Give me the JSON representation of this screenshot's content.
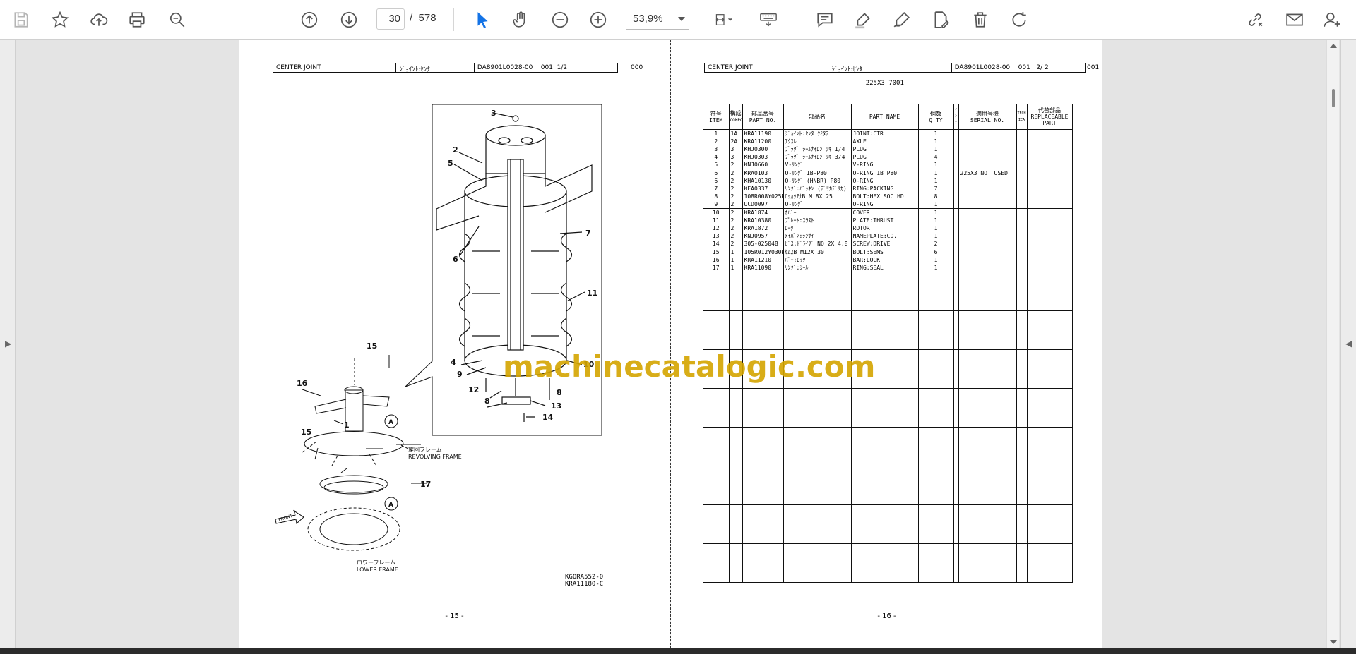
{
  "toolbar": {
    "page_current": "30",
    "page_separator": "/",
    "page_total": "578",
    "zoom": "53,9%"
  },
  "left_page": {
    "header": {
      "title": "CENTER JOINT",
      "jp_title": "ｼﾞｮｲﾝﾄ:ｾﾝﾀ",
      "doc_no": "DA8901L0028-00",
      "seq": "001",
      "sheet": "1/2",
      "rev": "000"
    },
    "callouts": [
      "1",
      "2",
      "3",
      "4",
      "5",
      "6",
      "7",
      "8",
      "8",
      "9",
      "10",
      "11",
      "12",
      "13",
      "14",
      "15",
      "15",
      "16",
      "17",
      "A",
      "A"
    ],
    "captions": {
      "revolving_jp": "旋回フレーム",
      "revolving_en": "REVOLVING FRAME",
      "lower_jp": "ロワーフレーム",
      "lower_en": "LOWER FRAME",
      "front": "FRONT"
    },
    "drawing_no_1": "KGORA552-0",
    "drawing_no_2": "KRA11180-C",
    "page_num": "- 15 -"
  },
  "right_page": {
    "header": {
      "title": "CENTER JOINT",
      "jp_title": "ｼﾞｮｲﾝﾄ:ｾﾝﾀ",
      "doc_no": "DA8901L0028-00",
      "seq": "001",
      "sheet": "2/ 2",
      "rev": "001"
    },
    "model": "225X3 7001—",
    "columns": {
      "item": [
        "符号",
        "ITEM"
      ],
      "compo": [
        "構成",
        "COMPO"
      ],
      "part_no": [
        "部品番号",
        "PART NO."
      ],
      "part_name_jp": "部品名",
      "part_name": "PART NAME",
      "qty": [
        "個数",
        "Q'TY"
      ],
      "note": "ｲﾝﾁ",
      "serial": [
        "適用号機",
        "SERIAL NO."
      ],
      "tech": [
        "TECH",
        "ICA"
      ],
      "replace": [
        "代替部品",
        "REPLACEABLE",
        "PART"
      ]
    },
    "rows": [
      {
        "item": "1",
        "compo": "1A",
        "part_no": "KRA11190",
        "jp": "ｼﾞｮｲﾝﾄ:ｾﾝﾀ ｸﾐﾀﾃ",
        "name": "JOINT:CTR",
        "qty": "1",
        "serial": "",
        "grp": false
      },
      {
        "item": "2",
        "compo": "2A",
        "part_no": "KRA11200",
        "jp": "ｱｸｽﾙ",
        "name": "AXLE",
        "qty": "1",
        "serial": "",
        "grp": false
      },
      {
        "item": "3",
        "compo": "3",
        "part_no": "KHJ0300",
        "jp": "ﾌﾟﾗｸﾞ ｼｰﾙﾅｲﾛﾝ ﾂｷ 1/4",
        "name": "PLUG",
        "qty": "1",
        "serial": "",
        "grp": false
      },
      {
        "item": "4",
        "compo": "3",
        "part_no": "KHJ0303",
        "jp": "ﾌﾟﾗｸﾞ ｼｰﾙﾅｲﾛﾝ ﾂｷ 3/4",
        "name": "PLUG",
        "qty": "4",
        "serial": "",
        "grp": false
      },
      {
        "item": "5",
        "compo": "2",
        "part_no": "KNJ0660",
        "jp": "V-ﾘﾝｸﾞ",
        "name": "V-RING",
        "qty": "1",
        "serial": "",
        "grp": false
      },
      {
        "item": "6",
        "compo": "2",
        "part_no": "KRA0103",
        "jp": "O-ﾘﾝｸﾞ 1B-P80",
        "name": "O-RING 1B P80",
        "qty": "1",
        "serial": "225X3  NOT USED",
        "grp": true
      },
      {
        "item": "6",
        "compo": "2",
        "part_no": "KHA10130",
        "jp": "O-ﾘﾝｸﾞ (HNBR) P80",
        "name": "O-RING",
        "qty": "1",
        "serial": "",
        "grp": false
      },
      {
        "item": "7",
        "compo": "2",
        "part_no": "KEA0337",
        "jp": "ﾘﾝｸﾞ:ﾊﾟｯｷﾝ (ﾃﾞﾘｶﾃﾞﾘｶ)",
        "name": "RING:PACKING",
        "qty": "7",
        "serial": "",
        "grp": false
      },
      {
        "item": "8",
        "compo": "2",
        "part_no": "108R008Y025R",
        "jp": "ﾛｯｶｸｱﾅB M 8X 25",
        "name": "BOLT:HEX SOC HD",
        "qty": "8",
        "serial": "",
        "grp": false
      },
      {
        "item": "9",
        "compo": "2",
        "part_no": "UCD0097",
        "jp": "O-ﾘﾝｸﾞ",
        "name": "O-RING",
        "qty": "1",
        "serial": "",
        "grp": false
      },
      {
        "item": "10",
        "compo": "2",
        "part_no": "KRA1874",
        "jp": "ｶﾊﾞｰ",
        "name": "COVER",
        "qty": "1",
        "serial": "",
        "grp": true
      },
      {
        "item": "11",
        "compo": "2",
        "part_no": "KRA10380",
        "jp": "ﾌﾟﾚｰﾄ:ｽﾗｽﾄ",
        "name": "PLATE:THRUST",
        "qty": "1",
        "serial": "",
        "grp": false
      },
      {
        "item": "12",
        "compo": "2",
        "part_no": "KRA1872",
        "jp": "ﾛｰﾀ",
        "name": "ROTOR",
        "qty": "1",
        "serial": "",
        "grp": false
      },
      {
        "item": "13",
        "compo": "2",
        "part_no": "KNJ0957",
        "jp": "ﾒｲﾊﾞﾝ:ｼﾝｻｲ",
        "name": "NAMEPLATE:CO.",
        "qty": "1",
        "serial": "",
        "grp": false
      },
      {
        "item": "14",
        "compo": "2",
        "part_no": "305-02504B",
        "jp": "ﾋﾞｽ:ﾄﾞﾗｲﾌﾞ NO 2X 4.8",
        "name": "SCREW:DRIVE",
        "qty": "2",
        "serial": "",
        "grp": false
      },
      {
        "item": "15",
        "compo": "1",
        "part_no": "105R012Y030R",
        "jp": "ｾﾑｽB M12X 30",
        "name": "BOLT:SEMS",
        "qty": "6",
        "serial": "",
        "grp": true
      },
      {
        "item": "16",
        "compo": "1",
        "part_no": "KRA11210",
        "jp": "ﾊﾞｰ:ﾛｯｸ",
        "name": "BAR:LOCK",
        "qty": "1",
        "serial": "",
        "grp": false
      },
      {
        "item": "17",
        "compo": "1",
        "part_no": "KRA11090",
        "jp": "ﾘﾝｸﾞ:ｼｰﾙ",
        "name": "RING:SEAL",
        "qty": "1",
        "serial": "",
        "grp": false
      }
    ],
    "page_num": "- 16 -"
  },
  "watermark": "machinecatalogic.com",
  "icons": [
    "save-icon",
    "bookmark-star-icon",
    "upload-cloud-icon",
    "print-icon",
    "zoom-search-icon",
    "arrow-up-circle-icon",
    "arrow-down-circle-icon",
    "select-cursor-icon",
    "hand-pan-icon",
    "zoom-out-icon",
    "zoom-in-icon",
    "page-fit-icon",
    "keyboard-icon",
    "comment-icon",
    "highlight-icon",
    "sign-icon",
    "edit-pdf-icon",
    "delete-icon",
    "rotate-icon",
    "share-link-icon",
    "email-icon",
    "add-user-icon"
  ],
  "colors": {
    "accent": "#1473e6",
    "watermark": "#d4a500"
  }
}
